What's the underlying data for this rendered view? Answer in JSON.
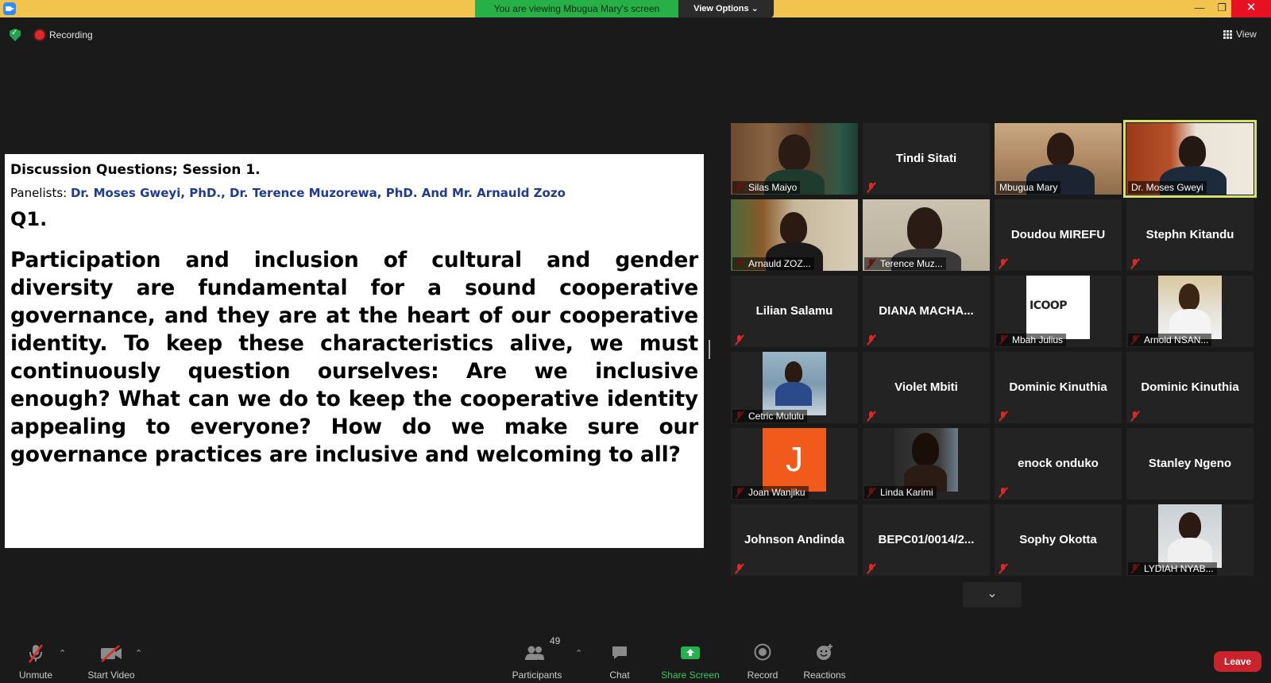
{
  "window": {
    "viewing_banner": "You are viewing Mbugua Mary's screen",
    "view_options_label": "View Options",
    "minimize_glyph": "—",
    "restore_glyph": "❐",
    "close_glyph": "✕"
  },
  "status": {
    "recording_label": "Recording",
    "view_label": "View"
  },
  "slide": {
    "title": "Discussion Questions; Session 1.",
    "panelists_label": "Panelists: ",
    "panelists_names": "Dr. Moses Gweyi, PhD., Dr. Terence Muzorewa, PhD. And Mr. Arnauld Zozo",
    "question_number": "Q1.",
    "question_text": "Participation and inclusion of cultural and gender diversity are fundamental for a sound cooperative governance, and they are at the heart of our cooperative identity. To keep these characteristics alive, we must continuously question ourselves: Are we inclusive enough? What can we do to keep the cooperative identity appealing to everyone? How do we make sure our governance practices are inclusive and welcoming to all?"
  },
  "gallery": {
    "tiles": [
      {
        "name": "Silas Maiyo"
      },
      {
        "name": "Tindi Sitati"
      },
      {
        "name": "Mbugua Mary"
      },
      {
        "name": "Dr. Moses Gweyi"
      },
      {
        "name": "Arnauld ZOZ..."
      },
      {
        "name": "Terence Muz..."
      },
      {
        "name": "Doudou MIREFU"
      },
      {
        "name": "Stephn Kitandu"
      },
      {
        "name": "Lilian Salamu"
      },
      {
        "name": "DIANA  MACHA..."
      },
      {
        "name": "Mbah Julius"
      },
      {
        "name": "Arnold NSAN..."
      },
      {
        "name": "Cetric Mululu"
      },
      {
        "name": "Violet Mbiti"
      },
      {
        "name": "Dominic Kinuthia"
      },
      {
        "name": "Dominic Kinuthia"
      },
      {
        "name": "Joan Wanjiku"
      },
      {
        "name": "Linda Karimi"
      },
      {
        "name": "enock onduko"
      },
      {
        "name": "Stanley Ngeno"
      },
      {
        "name": "Johnson Andinda"
      },
      {
        "name": "BEPC01/0014/2..."
      },
      {
        "name": "Sophy Okotta"
      },
      {
        "name": "LYDIAH NYAB..."
      }
    ],
    "joan_initial": "J",
    "icoop_logo": "ICOOP"
  },
  "toolbar": {
    "unmute_label": "Unmute",
    "start_video_label": "Start Video",
    "participants_label": "Participants",
    "participants_count": "49",
    "chat_label": "Chat",
    "share_screen_label": "Share Screen",
    "record_label": "Record",
    "reactions_label": "Reactions",
    "leave_label": "Leave"
  },
  "colors": {
    "top_bar": "#f2c34d",
    "viewing_banner": "#27b047",
    "leave": "#c9242b",
    "share_screen": "#23b24b",
    "active_speaker": "#d8e26a",
    "mute_red": "#e02828"
  }
}
